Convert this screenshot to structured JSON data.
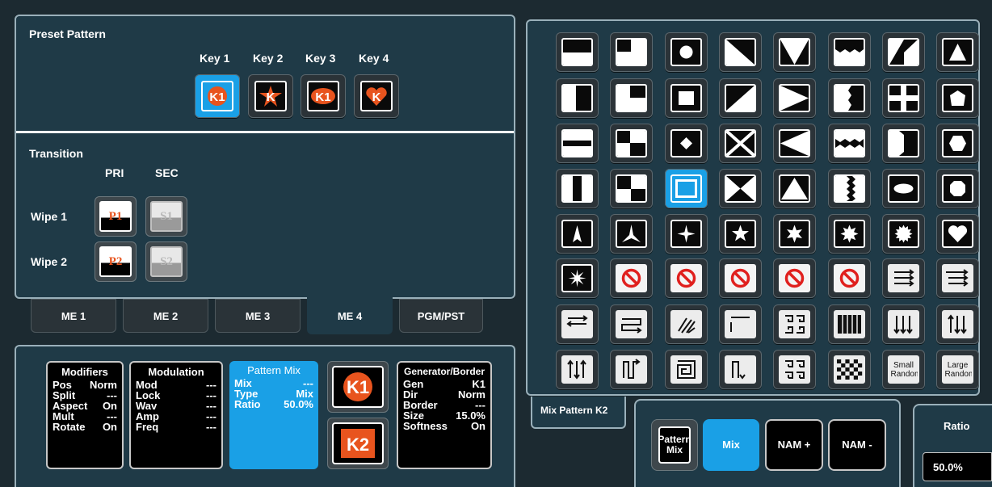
{
  "preset": {
    "title": "Preset Pattern",
    "keys": [
      {
        "label": "Key 1",
        "badge": "K1"
      },
      {
        "label": "Key 2",
        "badge": "K"
      },
      {
        "label": "Key 3",
        "badge": "K1"
      },
      {
        "label": "Key 4",
        "badge": "K"
      }
    ]
  },
  "transition": {
    "title": "Transition",
    "pri_label": "PRI",
    "sec_label": "SEC",
    "rows": [
      {
        "label": "Wipe 1",
        "pri": "P1",
        "sec": "S1"
      },
      {
        "label": "Wipe 2",
        "pri": "P2",
        "sec": "S2"
      }
    ]
  },
  "tabs": [
    "ME 1",
    "ME 2",
    "ME 3",
    "ME 4",
    "PGM/PST"
  ],
  "active_tab": "ME 4",
  "modifiers": {
    "title": "Modifiers",
    "rows": [
      [
        "Pos",
        "Norm"
      ],
      [
        "Split",
        "---"
      ],
      [
        "Aspect",
        "On"
      ],
      [
        "Mult",
        "---"
      ],
      [
        "Rotate",
        "On"
      ]
    ]
  },
  "modulation": {
    "title": "Modulation",
    "rows": [
      [
        "Mod",
        "---"
      ],
      [
        "Lock",
        "---"
      ],
      [
        "Wav",
        "---"
      ],
      [
        "Amp",
        "---"
      ],
      [
        "Freq",
        "---"
      ]
    ]
  },
  "pattern_mix": {
    "title": "Pattern Mix",
    "rows": [
      [
        "Mix",
        "---"
      ],
      [
        "Type",
        "Mix"
      ],
      [
        "Ratio",
        "50.0%"
      ]
    ]
  },
  "key_buttons": [
    "K1",
    "K2"
  ],
  "generator": {
    "title": "Generator/Border",
    "rows": [
      [
        "Gen",
        "K1"
      ],
      [
        "Dir",
        "Norm"
      ],
      [
        "Border",
        "---"
      ],
      [
        "Size",
        "15.0%"
      ],
      [
        "Softness",
        "On"
      ]
    ]
  },
  "mix_pattern": {
    "label": "Mix Pattern K2",
    "options": [
      "Pattern Mix",
      "Mix",
      "NAM +",
      "NAM -"
    ],
    "selected": "Mix"
  },
  "ratio": {
    "label": "Ratio",
    "value": "50.0%"
  },
  "random": {
    "small": "Small Random",
    "large": "Large Random"
  },
  "colors": {
    "accent": "#1aa0e6",
    "panel": "#1f3a47",
    "key_orange": "#e8541e",
    "forbidden_red": "#e0201e"
  },
  "pattern_icons": [
    "horizontal-wipe-icon",
    "corner-bottom-right-icon",
    "circle-icon",
    "diagonal-tl-icon",
    "v-wedge-down-icon",
    "zigzag-top-icon",
    "diagonal-br-notch-icon",
    "triangle-up-icon",
    "vertical-wipe-icon",
    "corner-top-left-icon",
    "square-icon",
    "diagonal-bl-icon",
    "arrow-right-icon",
    "zigzag-side-icon",
    "cross-icon",
    "pentagon-icon",
    "horizontal-split-icon",
    "corner-bottom-left-icon",
    "diamond-icon",
    "x-wipe-icon",
    "arrow-left-icon",
    "zigzag-band-icon",
    "door-icon",
    "hexagon-icon",
    "vertical-split-icon",
    "corner-top-right-icon",
    "square-selected-icon",
    "bowtie-icon",
    "triangle-up-large-icon",
    "zigzag-vertical-icon",
    "ellipse-icon",
    "octagon-icon",
    "star-3-icon",
    "star-3-wide-icon",
    "star-4-icon",
    "star-5-icon",
    "star-6-icon",
    "star-8-icon",
    "star-12-icon",
    "heart-icon",
    "star-burst-icon",
    "forbidden-icon",
    "forbidden-icon",
    "forbidden-icon",
    "forbidden-icon",
    "forbidden-icon",
    "lines-right-icon",
    "lines-right-staggered-icon",
    "lines-bidirectional-icon",
    "lines-fold-icon",
    "diagonal-spiral-icon",
    "lines-stagger-icon",
    "maze-icon",
    "vertical-bars-icon",
    "lines-down-icon",
    "lines-down-up-icon",
    "lines-up-down-icon",
    "snake-icon",
    "spiral-icon",
    "vertical-fold-icon",
    "maze-quad-icon",
    "checker-icon",
    "small-random-icon",
    "large-random-icon"
  ],
  "pattern_selected_index": 26
}
